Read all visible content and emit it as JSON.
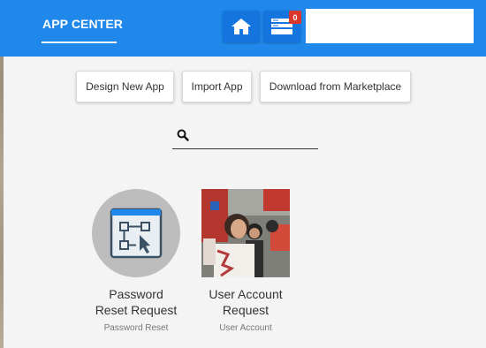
{
  "header": {
    "title": "APP CENTER",
    "home_icon": "home-icon",
    "notifications_icon": "inbox-icon",
    "notification_count": "0",
    "brand_color": "#1f88ea",
    "badge_color": "#d9362c"
  },
  "actions": {
    "design_label": "Design New App",
    "import_label": "Import App",
    "marketplace_label": "Download from Marketplace"
  },
  "search": {
    "placeholder": "",
    "value": ""
  },
  "apps": [
    {
      "title_line1": "Password",
      "title_line2": "Reset Request",
      "subtitle": "Password Reset",
      "icon": "workflow-icon"
    },
    {
      "title_line1": "User Account",
      "title_line2": "Request",
      "subtitle": "User Account",
      "icon": "photo-thumbnail"
    }
  ]
}
